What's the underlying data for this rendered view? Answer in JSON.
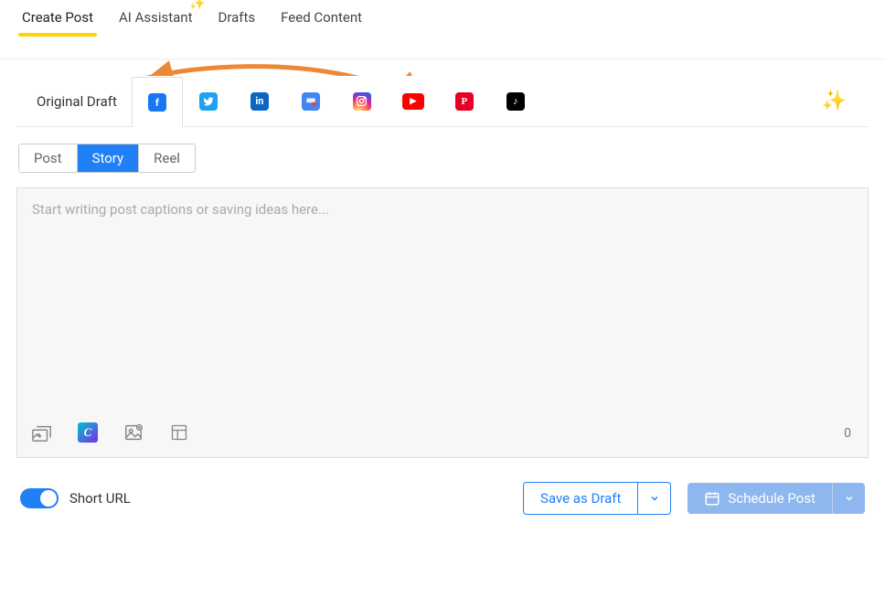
{
  "nav": {
    "tabs": [
      {
        "label": "Create Post",
        "active": true
      },
      {
        "label": "AI Assistant",
        "sparkle": true
      },
      {
        "label": "Drafts"
      },
      {
        "label": "Feed Content"
      }
    ]
  },
  "composer": {
    "original_draft_label": "Original Draft",
    "platforms": [
      {
        "id": "facebook",
        "glyph": "f",
        "selected": true
      },
      {
        "id": "twitter",
        "glyph": ""
      },
      {
        "id": "linkedin",
        "glyph": "in"
      },
      {
        "id": "google",
        "glyph": ""
      },
      {
        "id": "instagram",
        "glyph": ""
      },
      {
        "id": "youtube",
        "glyph": "▶"
      },
      {
        "id": "pinterest",
        "glyph": "P"
      },
      {
        "id": "tiktok",
        "glyph": "♪"
      }
    ],
    "post_types": {
      "items": [
        "Post",
        "Story",
        "Reel"
      ],
      "active": "Story"
    },
    "editor_placeholder": "Start writing post captions or saving ideas here...",
    "char_count": "0",
    "toolbar_icons": {
      "media": "media-icon",
      "canva": "C",
      "image": "image-icon",
      "template": "template-icon"
    }
  },
  "footer": {
    "short_url_label": "Short URL",
    "short_url_on": true,
    "save_draft_label": "Save as Draft",
    "schedule_label": "Schedule Post"
  }
}
